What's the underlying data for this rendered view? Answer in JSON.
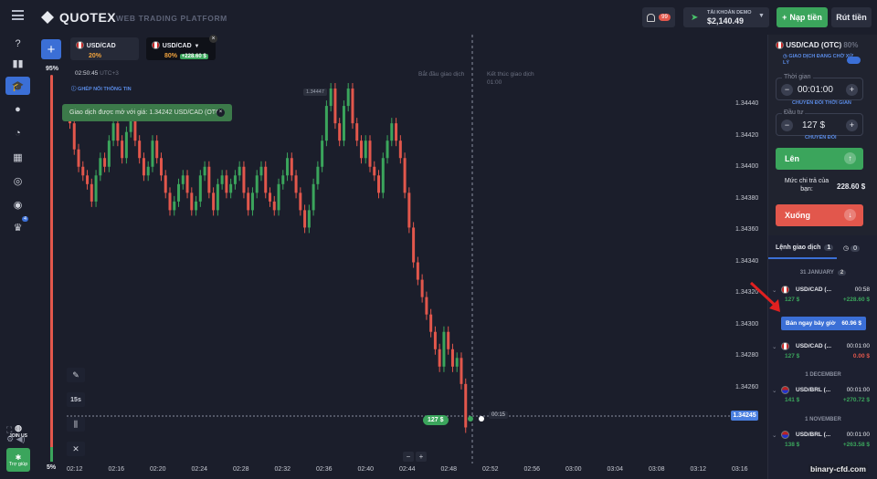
{
  "header": {
    "brand": "QUOTEX",
    "tagline": "WEB TRADING PLATFORM",
    "notif_count": "99",
    "account_label": "TÀI KHOẢN DEMO",
    "balance": "$2,140.49",
    "deposit_label": "Nạp tiền",
    "withdraw_label": "Rút tiền"
  },
  "sidebar": {
    "items": [
      {
        "icon": "help-icon"
      },
      {
        "icon": "chart-icon"
      },
      {
        "icon": "education-icon",
        "active": true
      },
      {
        "icon": "user-icon"
      },
      {
        "icon": "pie-icon"
      },
      {
        "icon": "market-icon"
      },
      {
        "icon": "signal-icon"
      },
      {
        "icon": "coins-icon"
      },
      {
        "icon": "trophy-icon",
        "badge": "4"
      }
    ],
    "join_us": "JOIN US",
    "support": "Trợ giúp"
  },
  "chart": {
    "tabs": [
      {
        "name": "USD/CAD",
        "pct": "20%"
      },
      {
        "name": "USD/CAD",
        "pct": "80%",
        "profit": "+228.60 $",
        "active": true
      }
    ],
    "sentiment_top": "95%",
    "sentiment_bottom": "5%",
    "clock": "02:50:45",
    "tz": "UTC+3",
    "copy_badge": "GHÉP NỐI THÔNG TIN",
    "toast": "Giao dịch được mở với giá: 1.34242 USD/CAD (OTC)",
    "notes": {
      "start": "Bắt đầu giao dịch",
      "end": "Kết thúc giao dịch",
      "end_time": "01:00"
    },
    "hi_price": "1.34447",
    "timeframe": "15s",
    "y_ticks": [
      "1.34440",
      "1.34420",
      "1.34400",
      "1.34380",
      "1.34360",
      "1.34340",
      "1.34320",
      "1.34300",
      "1.34280",
      "1.34260"
    ],
    "x_ticks": [
      "02:12",
      "02:16",
      "02:20",
      "02:24",
      "02:28",
      "02:32",
      "02:36",
      "02:40",
      "02:44",
      "02:48",
      "02:52",
      "02:56",
      "03:00",
      "03:04",
      "03:08",
      "03:12",
      "03:16"
    ],
    "current_price": "1.34245",
    "trade_pill": "127 $",
    "timer": "00:15"
  },
  "panel": {
    "asset": "USD/CAD (OTC)",
    "asset_pct": "80%",
    "pending": "GIAO DỊCH ĐANG CHỜ XỬ LÝ",
    "time_label": "Thời gian",
    "time_value": "00:01:00",
    "time_switch": "CHUYỂN ĐỔI THỜI GIAN",
    "invest_label": "Đầu tư",
    "invest_value": "127 $",
    "invest_switch": "CHUYỂN ĐỔI",
    "up_label": "Lên",
    "payout_label": "Mức chi trả của bạn:",
    "payout_value": "228.60 $",
    "down_label": "Xuống"
  },
  "trades": {
    "tab_label": "Lệnh giao dịch",
    "tab_count": "1",
    "tab2_count": "0",
    "groups": [
      {
        "date": "31 JANUARY",
        "count": "2"
      },
      {
        "date": "1 DECEMBER"
      },
      {
        "date": "1 NOVEMBER"
      }
    ],
    "rows": [
      {
        "name": "USD/CAD (...",
        "time": "00:58",
        "amount": "127 $",
        "pnl": "+228.60 $"
      },
      {
        "name": "USD/CAD (...",
        "time": "00:01:00",
        "amount": "127 $",
        "pnl": "0.00 $"
      },
      {
        "name": "USD/BRL (...",
        "time": "00:01:00",
        "amount": "141 $",
        "pnl": "+270.72 $"
      },
      {
        "name": "USD/BRL (...",
        "time": "00:01:00",
        "amount": "138 $",
        "pnl": "+263.58 $"
      }
    ],
    "sell_now": "Bán ngay bây giờ",
    "sell_value": "60.96 $"
  },
  "watermark": "binary-cfd.com",
  "chart_data": {
    "type": "candlestick",
    "xlabel": "",
    "ylabel": "",
    "ylim": [
      1.3424,
      1.3445
    ],
    "closes": [
      1.3442,
      1.34405,
      1.34395,
      1.3439,
      1.34385,
      1.34375,
      1.3439,
      1.344,
      1.34395,
      1.3441,
      1.3442,
      1.3441,
      1.344,
      1.34415,
      1.34425,
      1.3441,
      1.344,
      1.3439,
      1.34395,
      1.3441,
      1.344,
      1.3439,
      1.3438,
      1.3437,
      1.34375,
      1.34385,
      1.3439,
      1.3438,
      1.3437,
      1.34375,
      1.3439,
      1.34395,
      1.3438,
      1.3437,
      1.34385,
      1.3439,
      1.3438,
      1.34385,
      1.3439,
      1.34395,
      1.3438,
      1.3437,
      1.3438,
      1.3439,
      1.34395,
      1.3438,
      1.34375,
      1.3437,
      1.34385,
      1.3439,
      1.344,
      1.3439,
      1.3438,
      1.3437,
      1.3436,
      1.3437,
      1.34385,
      1.34395,
      1.3441,
      1.3443,
      1.3444,
      1.3442,
      1.3441,
      1.3443,
      1.3444,
      1.3442,
      1.3441,
      1.344,
      1.3441,
      1.34395,
      1.3439,
      1.3438,
      1.344,
      1.3441,
      1.3442,
      1.3441,
      1.344,
      1.3438,
      1.3436,
      1.3434,
      1.3433,
      1.3432,
      1.3431,
      1.343,
      1.3429,
      1.3428,
      1.343,
      1.3429,
      1.3428,
      1.34285,
      1.3427,
      1.34245
    ]
  }
}
